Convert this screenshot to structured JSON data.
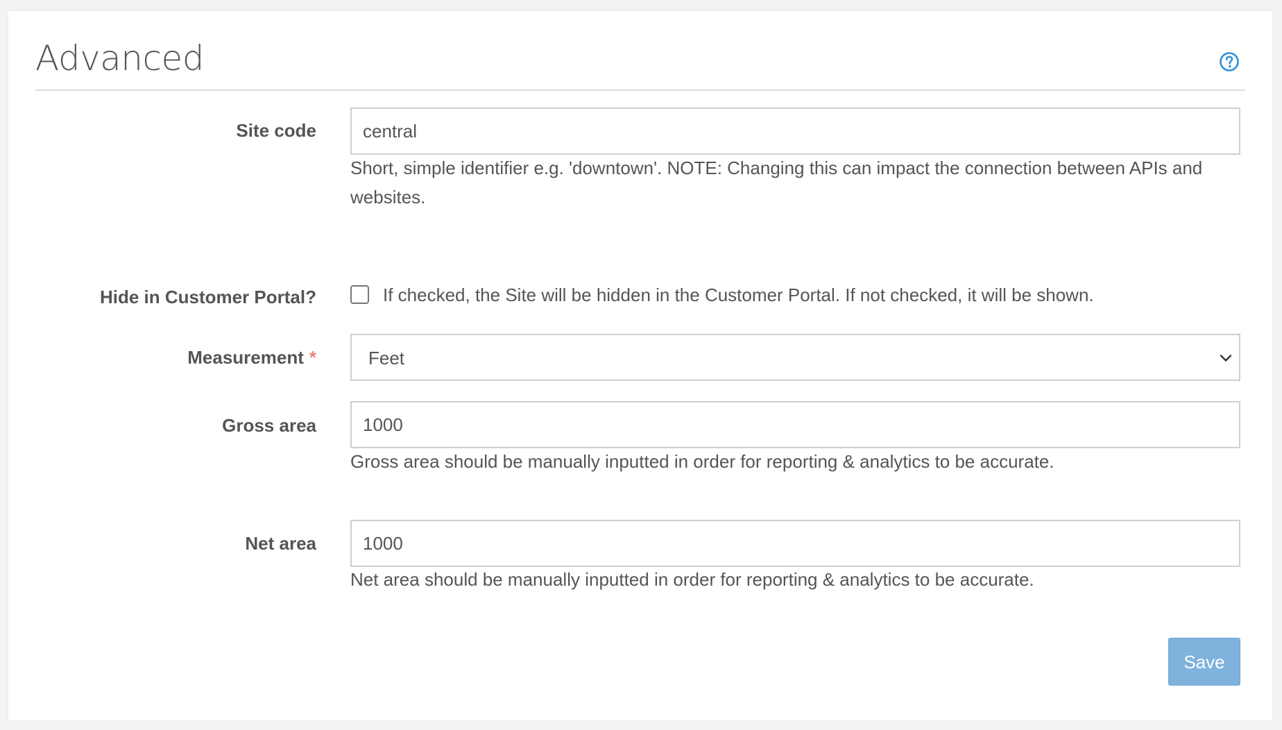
{
  "panel": {
    "title": "Advanced",
    "help_icon": "question-circle-icon",
    "accent_color": "#2d8fd5"
  },
  "site_code": {
    "label": "Site code",
    "value": "central",
    "help": "Short, simple identifier e.g. 'downtown'. NOTE: Changing this can impact the connection between APIs and websites."
  },
  "hide_portal": {
    "label": "Hide in Customer Portal?",
    "checked": false,
    "description": "If checked, the Site will be hidden in the Customer Portal. If not checked, it will be shown."
  },
  "measurement": {
    "label": "Measurement",
    "required_marker": "*",
    "selected": "Feet"
  },
  "gross_area": {
    "label": "Gross area",
    "value": "1000",
    "help": "Gross area should be manually inputted in order for reporting & analytics to be accurate."
  },
  "net_area": {
    "label": "Net area",
    "value": "1000",
    "help": "Net area should be manually inputted in order for reporting & analytics to be accurate."
  },
  "actions": {
    "save_label": "Save",
    "save_color": "#7fb2dd"
  }
}
